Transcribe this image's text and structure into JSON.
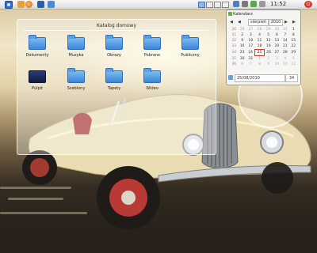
{
  "panel": {
    "clock_text": "11:52"
  },
  "folder_view": {
    "title": "Katalog domowy",
    "items": [
      {
        "label": "Dokumenty",
        "icon": "folder-icon"
      },
      {
        "label": "Muzyka",
        "icon": "folder-icon"
      },
      {
        "label": "Obrazy",
        "icon": "folder-icon"
      },
      {
        "label": "Pobrane",
        "icon": "folder-icon"
      },
      {
        "label": "Publiczny",
        "icon": "folder-icon"
      },
      {
        "label": "Pulpit",
        "icon": "desktop-icon"
      },
      {
        "label": "Szablony",
        "icon": "folder-icon"
      },
      {
        "label": "Tapety",
        "icon": "folder-icon"
      },
      {
        "label": "Wideo",
        "icon": "folder-icon"
      }
    ]
  },
  "calendar": {
    "title": "Kalendarz",
    "month": "sierpień",
    "year": "2010",
    "nav_prev": "◀",
    "nav_next": "▶",
    "weeks": [
      {
        "wk": "30",
        "days": [
          "26",
          "27",
          "28",
          "29",
          "30",
          "31",
          "1"
        ]
      },
      {
        "wk": "31",
        "days": [
          "2",
          "3",
          "4",
          "5",
          "6",
          "7",
          "8"
        ]
      },
      {
        "wk": "32",
        "days": [
          "9",
          "10",
          "11",
          "12",
          "13",
          "14",
          "15"
        ]
      },
      {
        "wk": "33",
        "days": [
          "16",
          "17",
          "18",
          "19",
          "20",
          "21",
          "22"
        ]
      },
      {
        "wk": "34",
        "days": [
          "23",
          "24",
          "25",
          "26",
          "27",
          "28",
          "29"
        ]
      },
      {
        "wk": "35",
        "days": [
          "30",
          "31",
          "1",
          "2",
          "3",
          "4",
          "5"
        ]
      },
      {
        "wk": "36",
        "days": [
          "6",
          "7",
          "8",
          "9",
          "10",
          "11",
          "12"
        ]
      }
    ],
    "selected_date": "25/08/2010",
    "week_number": "34"
  },
  "colors": {
    "accent": "#3b86d6",
    "today_border": "#d23a2a"
  }
}
